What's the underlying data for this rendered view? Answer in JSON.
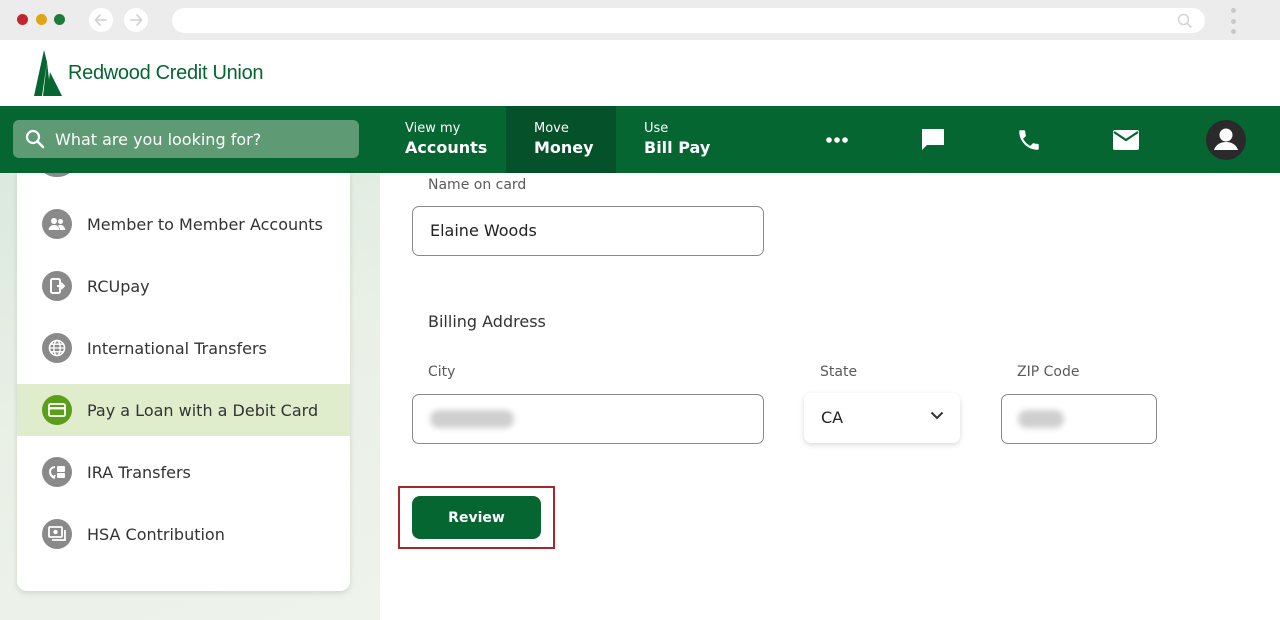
{
  "header": {
    "logo_text": "Redwood Credit Union"
  },
  "nav": {
    "search_placeholder": "What are you looking for?",
    "items": [
      {
        "small": "View my",
        "big": "Accounts"
      },
      {
        "small": "Move",
        "big": "Money"
      },
      {
        "small": "Use",
        "big": "Bill Pay"
      }
    ],
    "active_item": "Move Money",
    "icons": [
      "more-icon",
      "chat-icon",
      "phone-icon",
      "mail-icon",
      "profile-icon"
    ]
  },
  "sidebar": {
    "items": [
      {
        "label": "Member to Member Accounts",
        "icon": "members-icon"
      },
      {
        "label": "RCUpay",
        "icon": "rcupay-icon"
      },
      {
        "label": "International Transfers",
        "icon": "globe-icon"
      },
      {
        "label": "Pay a Loan with a Debit Card",
        "icon": "card-icon"
      },
      {
        "label": "IRA Transfers",
        "icon": "ira-icon"
      },
      {
        "label": "HSA Contribution",
        "icon": "hsa-icon"
      }
    ],
    "active_index": 3
  },
  "form": {
    "name_label": "Name on card",
    "name_value": "Elaine Woods",
    "billing_title": "Billing Address",
    "city_label": "City",
    "state_label": "State",
    "state_value": "CA",
    "zip_label": "ZIP Code",
    "review_label": "Review"
  },
  "colors": {
    "brand_green": "#066631",
    "active_nav": "#05522a",
    "sidebar_active": "#e0edcc",
    "highlight_border": "#a8262e"
  }
}
